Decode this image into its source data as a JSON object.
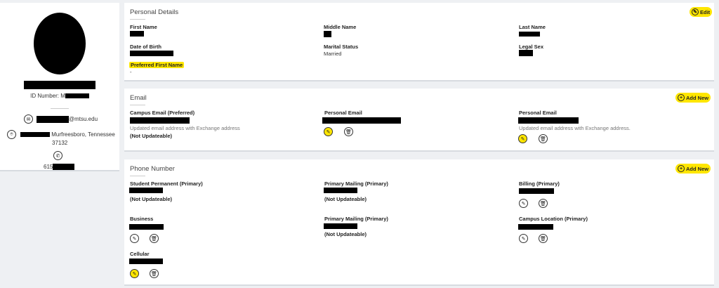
{
  "profile": {
    "id_label": "ID Number: M",
    "email_suffix": "@mtsu.edu",
    "address_line1": "Murfreesboro, Tennessee",
    "address_line2": "37132",
    "phone_prefix": "615"
  },
  "personal": {
    "title": "Personal Details",
    "edit_label": "Edit",
    "first_name_label": "First Name",
    "middle_name_label": "Middle Name",
    "last_name_label": "Last Name",
    "dob_label": "Date of Birth",
    "marital_label": "Marital Status",
    "marital_value": "Married",
    "legal_sex_label": "Legal Sex",
    "preferred_label": "Preferred First Name",
    "preferred_value": "-"
  },
  "email": {
    "title": "Email",
    "add_label": "Add New",
    "campus_label": "Campus Email (Preferred)",
    "campus_note": "Updated email address with Exchange address",
    "campus_status": "(Not Updateable)",
    "personal1_label": "Personal Email",
    "personal2_label": "Personal Email",
    "personal2_note": "Updated email address with Exchange address."
  },
  "phone": {
    "title": "Phone Number",
    "add_label": "Add New",
    "student_perm_label": "Student Permanent (Primary)",
    "student_perm_status": "(Not Updateable)",
    "primary_mail1_label": "Primary Mailing (Primary)",
    "primary_mail1_status": "(Not Updateable)",
    "billing_label": "Billing (Primary)",
    "business_label": "Business",
    "primary_mail2_label": "Primary Mailing (Primary)",
    "primary_mail2_status": "(Not Updateable)",
    "campus_loc_label": "Campus Location (Primary)",
    "cellular_label": "Cellular"
  },
  "icons": {
    "edit": "pencil-icon",
    "delete": "trash-icon",
    "add": "plus-circle-icon",
    "email": "envelope-icon",
    "address": "location-pin-icon",
    "phone": "phone-icon"
  },
  "colors": {
    "highlight": "#ffe600",
    "background": "#eef0f3",
    "panel": "#ffffff"
  }
}
